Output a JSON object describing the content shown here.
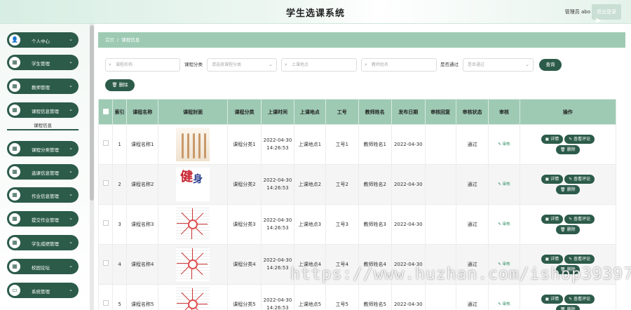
{
  "header": {
    "title": "学生选课系统",
    "admin": "管理员 abo",
    "logout": "退出登录"
  },
  "sidebar": {
    "items": [
      {
        "label": "个人中心",
        "icon": "user-icon",
        "glyph": "👤"
      },
      {
        "label": "学生管理",
        "icon": "grid-icon",
        "glyph": "▦"
      },
      {
        "label": "教师管理",
        "icon": "grid-icon",
        "glyph": "▦"
      },
      {
        "label": "课程信息管理",
        "icon": "grid-icon",
        "glyph": "▦"
      },
      {
        "label": "课程分类管理",
        "icon": "grid-icon",
        "glyph": "▦"
      },
      {
        "label": "选课信息管理",
        "icon": "grid-icon",
        "glyph": "▦"
      },
      {
        "label": "作业信息管理",
        "icon": "grid-icon",
        "glyph": "▦"
      },
      {
        "label": "提交作业管理",
        "icon": "grid-icon",
        "glyph": "▦"
      },
      {
        "label": "学生成绩管理",
        "icon": "grid-icon",
        "glyph": "▦"
      },
      {
        "label": "校园论坛",
        "icon": "grid-icon",
        "glyph": "▦"
      },
      {
        "label": "系统管理",
        "icon": "monitor-icon",
        "glyph": "▭"
      }
    ],
    "submenu": "课程信息",
    "arrow": "⌄"
  },
  "breadcrumb": {
    "home": "首页",
    "sep": "/",
    "current": "课程信息"
  },
  "filters": {
    "course_name_placeholder": "课程名称",
    "category_label": "课程分类",
    "category_placeholder": "请选择课程分类",
    "location_placeholder": "上课地点",
    "teacher_placeholder": "教师姓名",
    "approved_label": "是否通过",
    "approved_placeholder": "是否通过",
    "search_button": "查询",
    "delete_button": "删除"
  },
  "table": {
    "headers": [
      "",
      "索引",
      "课程名称",
      "课程封面",
      "课程分类",
      "上课时间",
      "上课地点",
      "工号",
      "教师姓名",
      "发布日期",
      "审核回复",
      "审核状态",
      "审核",
      "操作"
    ],
    "audit_link": "审核",
    "detail_button": "详情",
    "comment_button": "查看评论",
    "delete_button": "删除",
    "rows": [
      {
        "index": "1",
        "name": "课程名称1",
        "cover": "dance",
        "category": "课程分类1",
        "time": "2022-04-30 14:26:53",
        "location": "上课地点1",
        "job_no": "工号1",
        "teacher": "教师姓名1",
        "date": "2022-04-30",
        "reply": "",
        "status": "通过"
      },
      {
        "index": "2",
        "name": "课程名称2",
        "cover": "fitness",
        "category": "课程分类2",
        "time": "2022-04-30 14:26:53",
        "location": "上课地点2",
        "job_no": "工号2",
        "teacher": "教师姓名2",
        "date": "2022-04-30",
        "reply": "",
        "status": "通过"
      },
      {
        "index": "3",
        "name": "课程名称3",
        "cover": "mindmap",
        "category": "课程分类3",
        "time": "2022-04-30 14:26:53",
        "location": "上课地点3",
        "job_no": "工号3",
        "teacher": "教师姓名3",
        "date": "2022-04-30",
        "reply": "",
        "status": "通过"
      },
      {
        "index": "4",
        "name": "课程名称4",
        "cover": "mindmap",
        "category": "课程分类4",
        "time": "2022-04-30 14:26:53",
        "location": "上课地点4",
        "job_no": "工号4",
        "teacher": "教师姓名4",
        "date": "2022-04-30",
        "reply": "",
        "status": "通过"
      },
      {
        "index": "5",
        "name": "课程名称5",
        "cover": "mindmap",
        "category": "课程分类5",
        "time": "2022-04-30 14:26:53",
        "location": "上课地点5",
        "job_no": "工号5",
        "teacher": "教师姓名5",
        "date": "2022-04-30",
        "reply": "",
        "status": "通过"
      }
    ]
  },
  "cover_text": {
    "fitness_red": "健",
    "fitness_blue": "身"
  },
  "watermark": "https://www.huzhan.com/ishop39397"
}
